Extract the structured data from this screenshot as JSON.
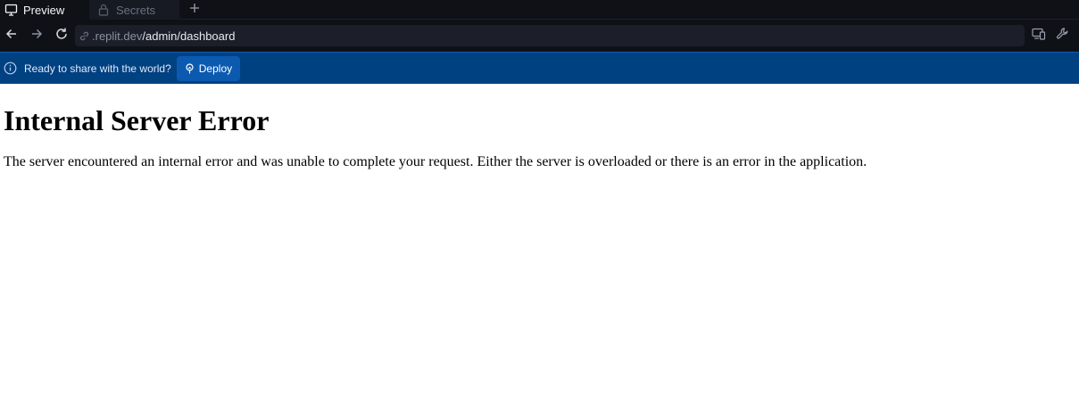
{
  "tabs": [
    {
      "label": "Preview",
      "icon": "monitor-icon",
      "active": true
    },
    {
      "label": "Secrets",
      "icon": "lock-icon",
      "active": false
    }
  ],
  "add_tab_icon": "plus-icon",
  "url": {
    "host": ".replit.dev",
    "path": "/admin/dashboard"
  },
  "banner": {
    "text": "Ready to share with the world?",
    "deploy_label": "Deploy"
  },
  "page": {
    "heading": "Internal Server Error",
    "message": "The server encountered an internal error and was unable to complete your request. Either the server is overloaded or there is an error in the application."
  },
  "colors": {
    "chrome_bg": "#0f1117",
    "banner_bg": "#004182",
    "deploy_bg": "#0b5ab0"
  }
}
